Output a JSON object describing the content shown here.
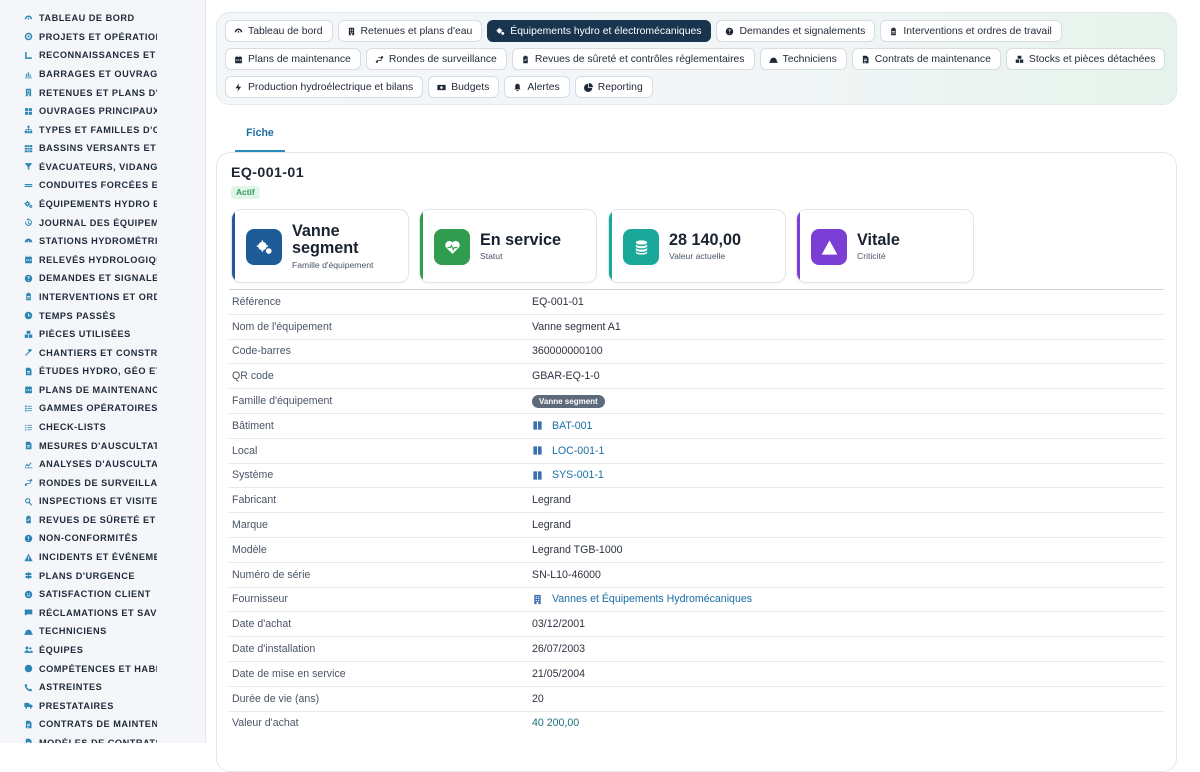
{
  "sidebar": {
    "items": [
      {
        "label": "TABLEAU DE BORD",
        "icon": "dashboard-icon"
      },
      {
        "label": "PROJETS ET OPÉRATIONS",
        "icon": "target-icon"
      },
      {
        "label": "RECONNAISSANCES ET VISITES",
        "icon": "ruler-icon"
      },
      {
        "label": "BARRAGES ET OUVRAGES",
        "icon": "chart-icon"
      },
      {
        "label": "RETENUES ET PLANS D'EAU",
        "icon": "building-icon"
      },
      {
        "label": "OUVRAGES PRINCIPAUX",
        "icon": "tools-icon"
      },
      {
        "label": "TYPES ET FAMILLES D'OUVRAGES",
        "icon": "sitemap-icon"
      },
      {
        "label": "BASSINS VERSANTS ET AFFLUENTS",
        "icon": "grid-icon"
      },
      {
        "label": "ÉVACUATEURS, VIDANGES",
        "icon": "filter-icon"
      },
      {
        "label": "CONDUITES FORCÉES ET GALERIES",
        "icon": "pipe-icon"
      },
      {
        "label": "ÉQUIPEMENTS HYDRO ET ÉLECTROMÉCANIQUES",
        "icon": "gears-icon"
      },
      {
        "label": "JOURNAL DES ÉQUIPEMENTS",
        "icon": "history-icon"
      },
      {
        "label": "STATIONS HYDROMÉTRIQUES",
        "icon": "gauge-icon"
      },
      {
        "label": "RELEVÉS HYDROLOGIQUES",
        "icon": "calendar-icon"
      },
      {
        "label": "DEMANDES ET SIGNALEMENTS",
        "icon": "question-icon"
      },
      {
        "label": "INTERVENTIONS ET ORDRES DE TRAVAIL",
        "icon": "clipboard-icon"
      },
      {
        "label": "TEMPS PASSÉS",
        "icon": "clock-icon"
      },
      {
        "label": "PIÈCES UTILISÉES",
        "icon": "boxes-icon"
      },
      {
        "label": "CHANTIERS ET CONSTRUCTIONS",
        "icon": "hammer-icon"
      },
      {
        "label": "ÉTUDES HYDRO, GÉO ET GÉOTECHNIQUES",
        "icon": "document-icon"
      },
      {
        "label": "PLANS DE MAINTENANCE",
        "icon": "calendar-icon"
      },
      {
        "label": "GAMMES OPÉRATOIRES",
        "icon": "list-icon"
      },
      {
        "label": "CHECK-LISTS",
        "icon": "checklist-icon"
      },
      {
        "label": "MESURES D'AUSCULTATION",
        "icon": "document-icon"
      },
      {
        "label": "ANALYSES D'AUSCULTATION",
        "icon": "line-chart-icon"
      },
      {
        "label": "RONDES DE SURVEILLANCE",
        "icon": "route-icon"
      },
      {
        "label": "INSPECTIONS ET VISITES",
        "icon": "search-icon"
      },
      {
        "label": "REVUES DE SÛRETÉ ET CONTRÔLES",
        "icon": "clipboard-check-icon"
      },
      {
        "label": "NON-CONFORMITÉS",
        "icon": "exclamation-icon"
      },
      {
        "label": "INCIDENTS ET ÉVÉNEMENTS",
        "icon": "warning-icon"
      },
      {
        "label": "PLANS D'URGENCE",
        "icon": "signpost-icon"
      },
      {
        "label": "SATISFACTION CLIENT",
        "icon": "smile-icon"
      },
      {
        "label": "RÉCLAMATIONS ET SAV",
        "icon": "comment-icon"
      },
      {
        "label": "TECHNICIENS",
        "icon": "helmet-icon"
      },
      {
        "label": "ÉQUIPES",
        "icon": "users-icon"
      },
      {
        "label": "COMPÉTENCES ET HABILITATIONS",
        "icon": "badge-icon"
      },
      {
        "label": "ASTREINTES",
        "icon": "phone-icon"
      },
      {
        "label": "PRESTATAIRES",
        "icon": "truck-icon"
      },
      {
        "label": "CONTRATS DE MAINTENANCE",
        "icon": "contract-icon"
      },
      {
        "label": "MODÈLES DE CONTRATS",
        "icon": "document-icon"
      }
    ]
  },
  "topnav": {
    "rows": [
      [
        {
          "label": "Tableau de bord",
          "icon": "dashboard-icon",
          "active": false
        },
        {
          "label": "Retenues et plans d'eau",
          "icon": "building-icon",
          "active": false
        },
        {
          "label": "Équipements hydro et électromécaniques",
          "icon": "gears-icon",
          "active": true
        },
        {
          "label": "Demandes et signalements",
          "icon": "question-icon",
          "active": false
        },
        {
          "label": "Interventions et ordres de travail",
          "icon": "clipboard-icon",
          "active": false
        }
      ],
      [
        {
          "label": "Plans de maintenance",
          "icon": "calendar-icon",
          "active": false
        },
        {
          "label": "Rondes de surveillance",
          "icon": "route-icon",
          "active": false
        },
        {
          "label": "Revues de sûreté et contrôles réglementaires",
          "icon": "clipboard-check-icon",
          "active": false
        },
        {
          "label": "Techniciens",
          "icon": "helmet-icon",
          "active": false
        },
        {
          "label": "Contrats de maintenance",
          "icon": "contract-icon",
          "active": false
        },
        {
          "label": "Stocks et pièces détachées",
          "icon": "boxes-icon",
          "active": false
        }
      ],
      [
        {
          "label": "Production hydroélectrique et bilans",
          "icon": "bolt-icon",
          "active": false
        },
        {
          "label": "Budgets",
          "icon": "money-icon",
          "active": false
        },
        {
          "label": "Alertes",
          "icon": "bell-icon",
          "active": false
        },
        {
          "label": "Reporting",
          "icon": "pie-icon",
          "active": false
        }
      ]
    ]
  },
  "tabs": {
    "fiche": "Fiche"
  },
  "equipment": {
    "code": "EQ-001-01",
    "status_badge": "Actif"
  },
  "stats": [
    {
      "value": "Vanne segment",
      "label": "Famille d'équipement",
      "icon": "gears-icon",
      "color": "#1f5b96",
      "accent": "#1f5b96"
    },
    {
      "value": "En service",
      "label": "Statut",
      "icon": "heartbeat-icon",
      "color": "#2f9c4f",
      "accent": "#2f9c4f"
    },
    {
      "value": "28 140,00",
      "label": "Valeur actuelle",
      "icon": "coins-icon",
      "color": "#1aa89a",
      "accent": "#1aa89a"
    },
    {
      "value": "Vitale",
      "label": "Criticité",
      "icon": "warning-icon",
      "color": "#7c3fd6",
      "accent": "#7c3fd6"
    }
  ],
  "details": [
    {
      "label": "Référence",
      "value": "EQ-001-01",
      "type": "text"
    },
    {
      "label": "Nom de l'équipement",
      "value": "Vanne segment A1",
      "type": "text"
    },
    {
      "label": "Code-barres",
      "value": "360000000100",
      "type": "text"
    },
    {
      "label": "QR code",
      "value": "GBAR-EQ-1-0",
      "type": "text"
    },
    {
      "label": "Famille d'équipement",
      "value": "Vanne segment",
      "type": "pill"
    },
    {
      "label": "Bâtiment",
      "value": "BAT-001",
      "type": "link",
      "icon": "book-icon"
    },
    {
      "label": "Local",
      "value": "LOC-001-1",
      "type": "link",
      "icon": "book-icon"
    },
    {
      "label": "Système",
      "value": "SYS-001-1",
      "type": "link",
      "icon": "book-icon"
    },
    {
      "label": "Fabricant",
      "value": "Legrand",
      "type": "text"
    },
    {
      "label": "Marque",
      "value": "Legrand",
      "type": "text"
    },
    {
      "label": "Modèle",
      "value": "Legrand TGB-1000",
      "type": "text"
    },
    {
      "label": "Numéro de série",
      "value": "SN-L10-46000",
      "type": "text"
    },
    {
      "label": "Fournisseur",
      "value": "Vannes et Équipements Hydromécaniques",
      "type": "link",
      "icon": "building-icon"
    },
    {
      "label": "Date d'achat",
      "value": "03/12/2001",
      "type": "text"
    },
    {
      "label": "Date d'installation",
      "value": "26/07/2003",
      "type": "text"
    },
    {
      "label": "Date de mise en service",
      "value": "21/05/2004",
      "type": "text"
    },
    {
      "label": "Durée de vie (ans)",
      "value": "20",
      "type": "text"
    },
    {
      "label": "Valeur d'achat",
      "value": "40 200,00",
      "type": "money"
    }
  ]
}
